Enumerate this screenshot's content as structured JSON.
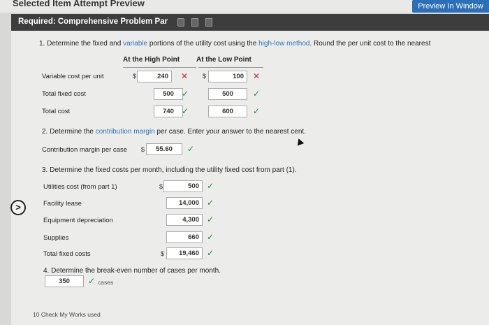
{
  "window": {
    "title": "Selected Item Attempt Preview",
    "preview_button": "Preview In Window"
  },
  "header": {
    "required_label": "Required: Comprehensive Problem Par"
  },
  "q1": {
    "text_a": "1. Determine the fixed and ",
    "text_b": "variable",
    "text_c": " portions of the utility cost using the ",
    "text_d": "high-low method",
    "text_e": ". Round the per unit cost to the nearest",
    "col_high": "At the High Point",
    "col_low": "At the Low Point",
    "rows": [
      {
        "label": "Variable cost per unit",
        "high": "240",
        "high_mark": "✕",
        "low": "100",
        "low_mark": "✕",
        "dollar": "$"
      },
      {
        "label": "Total fixed cost",
        "high": "500",
        "high_mark": "✓",
        "low": "500",
        "low_mark": "✓"
      },
      {
        "label": "Total cost",
        "high": "740",
        "high_mark": "✓",
        "low": "600",
        "low_mark": "✓"
      }
    ]
  },
  "q2": {
    "text_a": "2. Determine the ",
    "text_b": "contribution margin",
    "text_c": " per case. Enter your answer to the nearest cent.",
    "label": "Contribution margin per case",
    "dollar": "$",
    "value": "55.60",
    "mark": "✓"
  },
  "q3": {
    "text": "3. Determine the fixed costs per month, including the utility fixed cost from part (1).",
    "dollar": "$",
    "rows": [
      {
        "label": "Utilities cost (from part 1)",
        "value": "500",
        "mark": "✓"
      },
      {
        "label": "Facility lease",
        "value": "14,000",
        "mark": "✓"
      },
      {
        "label": "Equipment depreciation",
        "value": "4,300",
        "mark": "✓"
      },
      {
        "label": "Supplies",
        "value": "660",
        "mark": "✓"
      },
      {
        "label": "Total fixed costs",
        "value": "19,460",
        "mark": "✓"
      }
    ]
  },
  "q4": {
    "text": "4. Determine the break-even number of cases per month.",
    "value": "350",
    "mark": "✓",
    "unit": "cases"
  },
  "footer": {
    "text": "10 Check My Works used"
  },
  "nav": {
    "arrow": ">"
  }
}
